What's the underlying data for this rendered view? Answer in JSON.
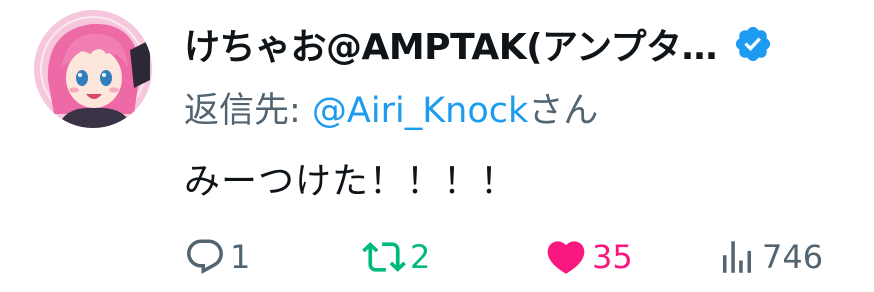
{
  "author": {
    "display_name": "けちゃお@AMPTAK(アンプタ…",
    "verified": true
  },
  "reply_context": {
    "prefix": "返信先: ",
    "mention": "@Airi_Knock",
    "suffix": "さん"
  },
  "tweet_text": "みーつけた！！！！",
  "actions": {
    "reply_count": "1",
    "retweet_count": "2",
    "like_count": "35",
    "view_count": "746"
  },
  "colors": {
    "verified": "#1d9bf0",
    "mention": "#1d9bf0",
    "retweet": "#00ba7c",
    "like": "#f91880",
    "muted": "#536471"
  },
  "icons": {
    "reply": "reply-bubble-icon",
    "retweet": "retweet-icon",
    "like": "heart-filled-icon",
    "views": "bar-chart-icon",
    "verified": "verified-badge-icon"
  }
}
